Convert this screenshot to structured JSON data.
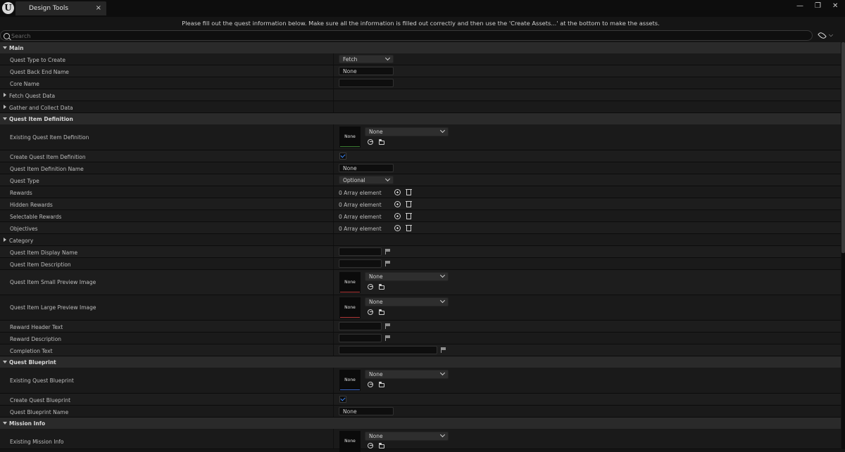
{
  "window": {
    "tab_title": "Design Tools",
    "tab_close": "×",
    "minimize": "—",
    "restore": "❐",
    "close": "✕"
  },
  "instructions": "Please fill out the quest information below. Make sure all the information is filled out correctly and then use the 'Create Assets...' at the bottom to make the assets.",
  "search": {
    "placeholder": "Search",
    "value": ""
  },
  "colors": {
    "accent_blue": "#3e8bff",
    "thumb_green": "#3a7a32",
    "thumb_red": "#b03838",
    "thumb_blue": "#3a66c8"
  },
  "icons": {
    "logo": "unreal-engine-logo-icon",
    "search": "search-icon",
    "visibility": "eye-icon",
    "add": "plus-circle-icon",
    "remove": "trash-icon",
    "localize": "flag-icon",
    "use_selected": "use-selected-arrow-icon",
    "browse": "browse-folder-icon"
  },
  "sections": {
    "main": {
      "label": "Main",
      "quest_type_label": "Quest Type to Create",
      "quest_type_value": "Fetch",
      "back_end_label": "Quest Back End Name",
      "back_end_value": "None",
      "core_name_label": "Core Name",
      "core_name_value": ""
    },
    "fetch_quest_data": {
      "label": "Fetch Quest Data"
    },
    "gather_collect_data": {
      "label": "Gather and Collect Data"
    },
    "quest_item_definition": {
      "label": "Quest Item Definition",
      "existing_label": "Existing Quest Item Definition",
      "existing_thumb": "None",
      "existing_value": "None",
      "create_label": "Create Quest Item Definition",
      "create_checked": true,
      "name_label": "Quest Item Definition Name",
      "name_value": "None",
      "quest_type_label": "Quest Type",
      "quest_type_value": "Optional",
      "rewards_label": "Rewards",
      "rewards_value": "0 Array element",
      "hidden_rewards_label": "Hidden Rewards",
      "hidden_rewards_value": "0 Array element",
      "selectable_rewards_label": "Selectable Rewards",
      "selectable_rewards_value": "0 Array element",
      "objectives_label": "Objectives",
      "objectives_value": "0 Array element",
      "category_label": "Category",
      "display_name_label": "Quest Item Display Name",
      "description_label": "Quest Item Description",
      "small_preview_label": "Quest Item Small Preview Image",
      "small_preview_thumb": "None",
      "small_preview_value": "None",
      "large_preview_label": "Quest Item Large Preview Image",
      "large_preview_thumb": "None",
      "large_preview_value": "None",
      "reward_header_label": "Reward Header Text",
      "reward_description_label": "Reward Description",
      "completion_text_label": "Completion Text"
    },
    "quest_blueprint": {
      "label": "Quest Blueprint",
      "existing_label": "Existing Quest Blueprint",
      "existing_thumb": "None",
      "existing_value": "None",
      "create_label": "Create Quest Blueprint",
      "create_checked": true,
      "name_label": "Quest Blueprint Name",
      "name_value": "None"
    },
    "mission_info": {
      "label": "Mission Info",
      "existing_label": "Existing Mission Info",
      "existing_thumb": "None",
      "existing_value": "None"
    }
  }
}
